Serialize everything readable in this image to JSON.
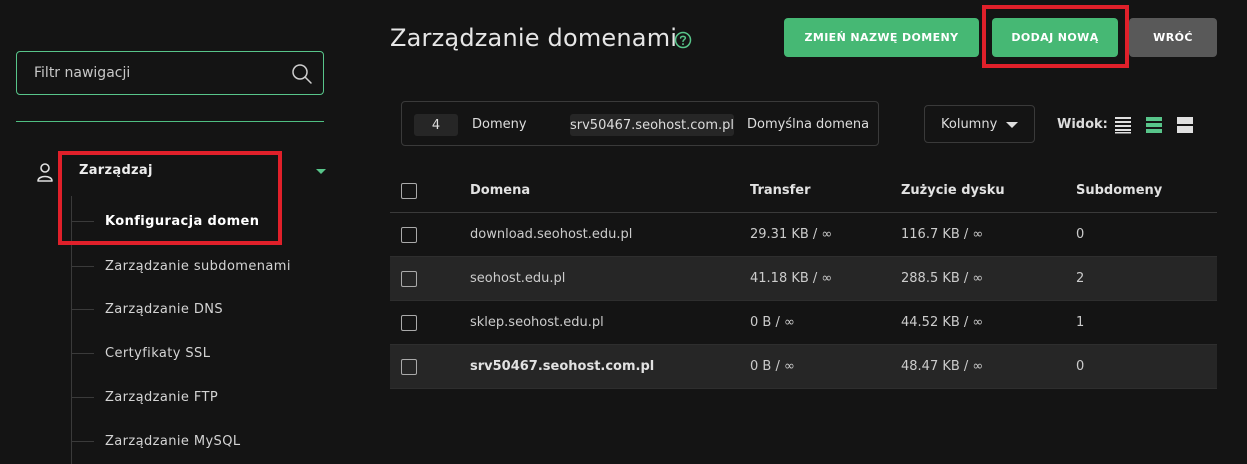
{
  "sidebar": {
    "filter_placeholder": "Filtr nawigacji",
    "section_label": "Zarządzaj",
    "items": [
      {
        "label": "Konfiguracja domen",
        "active": true
      },
      {
        "label": "Zarządzanie subdomenami"
      },
      {
        "label": "Zarządzanie DNS"
      },
      {
        "label": "Certyfikaty SSL"
      },
      {
        "label": "Zarządzanie FTP"
      },
      {
        "label": "Zarządzanie MySQL"
      }
    ]
  },
  "header": {
    "title": "Zarządzanie domenami",
    "buttons": {
      "rename": "ZMIEŃ NAZWĘ DOMENY",
      "add": "DODAJ NOWĄ",
      "back": "WRÓĆ"
    }
  },
  "summary": {
    "count": "4",
    "count_label": "Domeny",
    "default_domain": "srv50467.seohost.com.pl",
    "default_label": "Domyślna domena"
  },
  "toolbar": {
    "columns_label": "Kolumny",
    "view_label": "Widok:"
  },
  "table": {
    "columns": [
      "Domena",
      "Transfer",
      "Zużycie dysku",
      "Subdomeny"
    ],
    "rows": [
      {
        "domain": "download.seohost.edu.pl",
        "transfer": "29.31 KB / ∞",
        "disk": "116.7 KB / ∞",
        "subdomains": "0"
      },
      {
        "domain": "seohost.edu.pl",
        "transfer": "41.18 KB / ∞",
        "disk": "288.5 KB / ∞",
        "subdomains": "2"
      },
      {
        "domain": "sklep.seohost.edu.pl",
        "transfer": "0 B / ∞",
        "disk": "44.52 KB / ∞",
        "subdomains": "1"
      },
      {
        "domain": "srv50467.seohost.com.pl",
        "transfer": "0 B / ∞",
        "disk": "48.47 KB / ∞",
        "subdomains": "0"
      }
    ]
  },
  "colors": {
    "accent": "#46b874",
    "highlight": "#e0202a",
    "background": "#141414",
    "row_alt": "#262626"
  },
  "icons": {
    "search": "search-icon",
    "user": "user-icon",
    "help": "help-icon",
    "caret": "caret-down-icon",
    "view_list": "view-list-icon",
    "view_compact": "view-compact-icon",
    "view_grid": "view-grid-icon"
  }
}
